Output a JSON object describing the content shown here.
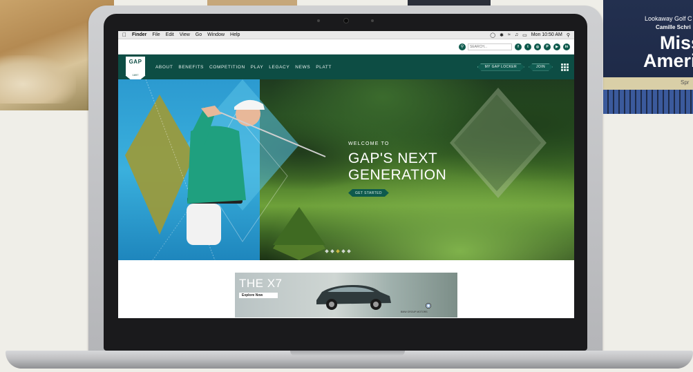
{
  "background": {
    "poster": {
      "line1": "Lookaway Golf C",
      "line2": "Camille Schri",
      "line3": "Miss",
      "line4": "Ameri",
      "line5": "Spr"
    }
  },
  "menubar": {
    "apple": "",
    "items": [
      "Finder",
      "File",
      "Edit",
      "View",
      "Go",
      "Window",
      "Help"
    ],
    "clock": "Mon 10:50 AM"
  },
  "utilbar": {
    "search_placeholder": "SEARCH...",
    "social": [
      "f",
      "t",
      "◎",
      "P",
      "▶",
      "in"
    ]
  },
  "nav": {
    "logo_text": "GAP",
    "logo_year": "1897",
    "links": [
      "ABOUT",
      "BENEFITS",
      "COMPETITION",
      "PLAY",
      "LEGACY",
      "NEWS",
      "PLATT"
    ],
    "locker": "MY GAP LOCKER",
    "join": "JOIN"
  },
  "hero": {
    "welcome": "WELCOME TO",
    "title": "GAP'S NEXT GENERATION",
    "cta": "GET STARTED",
    "slides": 5,
    "active_slide": 2
  },
  "ad": {
    "title": "THE X7",
    "button": "Explore Now",
    "fine_print": "BMW GROUP MOTORS"
  },
  "colors": {
    "brand_green": "#0d4d44",
    "sky_blue": "#2c9ad0",
    "olive": "#9c9a3a"
  }
}
